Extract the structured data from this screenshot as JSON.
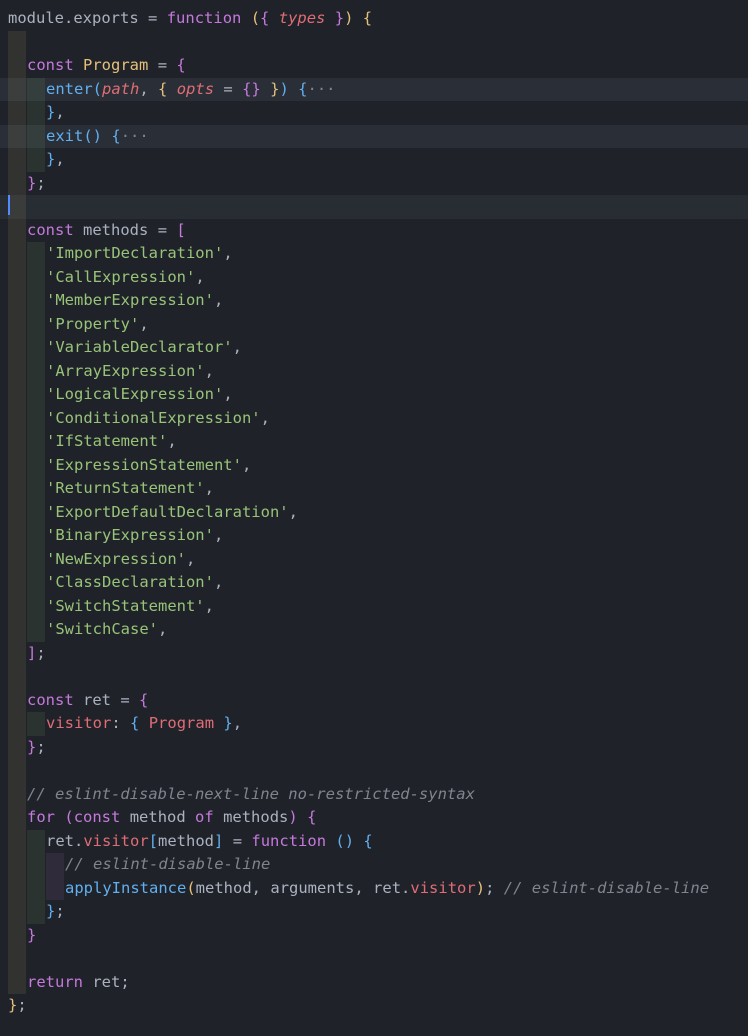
{
  "editor": {
    "language": "javascript",
    "colors": {
      "background": "#1f2329",
      "keyword": "#c678dd",
      "string": "#98c379",
      "function": "#61afef",
      "param": "#e06c75",
      "comment": "#7f848e",
      "error_squiggle": "#e06c75"
    },
    "lines": [
      {
        "indent": 0,
        "text": "module.exports = function ({ types }) {"
      },
      {
        "indent": 1,
        "text": ""
      },
      {
        "indent": 1,
        "text": "const Program = {"
      },
      {
        "indent": 2,
        "text": "enter(path, { opts = {} }) {···",
        "hl": true
      },
      {
        "indent": 2,
        "text": "},"
      },
      {
        "indent": 2,
        "text": "exit() {···",
        "hl": true
      },
      {
        "indent": 2,
        "text": "},"
      },
      {
        "indent": 1,
        "text": "};"
      },
      {
        "indent": 1,
        "text": "",
        "cursor": true
      },
      {
        "indent": 1,
        "text": "const methods = ["
      },
      {
        "indent": 2,
        "text": "'ImportDeclaration',"
      },
      {
        "indent": 2,
        "text": "'CallExpression',"
      },
      {
        "indent": 2,
        "text": "'MemberExpression',"
      },
      {
        "indent": 2,
        "text": "'Property',"
      },
      {
        "indent": 2,
        "text": "'VariableDeclarator',"
      },
      {
        "indent": 2,
        "text": "'ArrayExpression',"
      },
      {
        "indent": 2,
        "text": "'LogicalExpression',"
      },
      {
        "indent": 2,
        "text": "'ConditionalExpression',"
      },
      {
        "indent": 2,
        "text": "'IfStatement',"
      },
      {
        "indent": 2,
        "text": "'ExpressionStatement',"
      },
      {
        "indent": 2,
        "text": "'ReturnStatement',"
      },
      {
        "indent": 2,
        "text": "'ExportDefaultDeclaration',"
      },
      {
        "indent": 2,
        "text": "'BinaryExpression',"
      },
      {
        "indent": 2,
        "text": "'NewExpression',"
      },
      {
        "indent": 2,
        "text": "'ClassDeclaration',"
      },
      {
        "indent": 2,
        "text": "'SwitchStatement',"
      },
      {
        "indent": 2,
        "text": "'SwitchCase',"
      },
      {
        "indent": 1,
        "text": "];"
      },
      {
        "indent": 1,
        "text": ""
      },
      {
        "indent": 1,
        "text": "const ret = {"
      },
      {
        "indent": 2,
        "text": "visitor: { Program },"
      },
      {
        "indent": 1,
        "text": "};"
      },
      {
        "indent": 1,
        "text": ""
      },
      {
        "indent": 1,
        "text": "// eslint-disable-next-line no-restricted-syntax"
      },
      {
        "indent": 1,
        "text": "for (const method of methods) {"
      },
      {
        "indent": 2,
        "text": "ret.visitor[method] = function () {"
      },
      {
        "indent": 3,
        "text": "// eslint-disable-line"
      },
      {
        "indent": 3,
        "text": "applyInstance(method, arguments, ret.visitor); // eslint-disable-line"
      },
      {
        "indent": 2,
        "text": "};"
      },
      {
        "indent": 1,
        "text": "}"
      },
      {
        "indent": 1,
        "text": ""
      },
      {
        "indent": 1,
        "text": "return ret;"
      },
      {
        "indent": 0,
        "text": "};"
      }
    ]
  }
}
